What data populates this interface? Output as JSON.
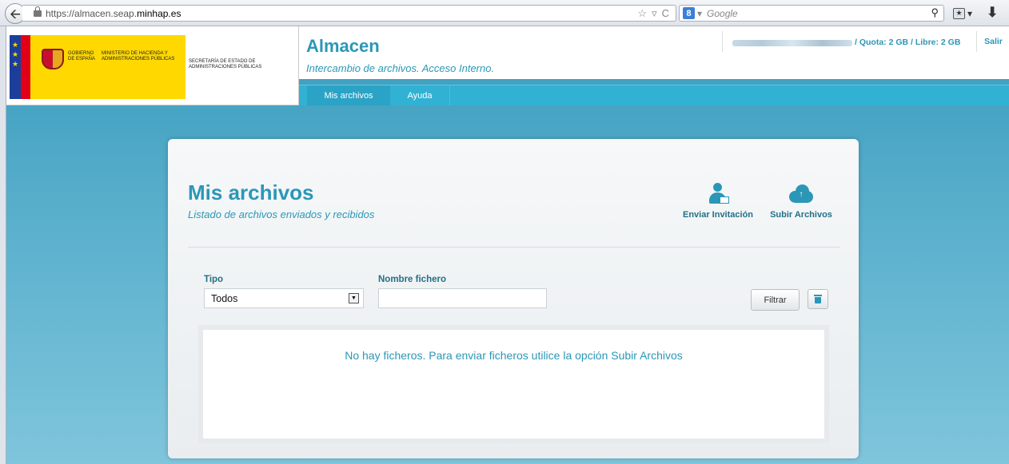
{
  "browser": {
    "url_prefix": "https://almacen.seap.",
    "url_host": "minhap.es",
    "search_engine_glyph": "8",
    "search_placeholder": "Google",
    "reload_glyph": "C",
    "star_glyph": "☆",
    "search_go_glyph": "⚲",
    "download_glyph": "⬇"
  },
  "header": {
    "gobierno_text": "GOBIERNO DE ESPAÑA",
    "ministerio_text": "MINISTERIO DE HACIENDA Y ADMINISTRACIONES PÚBLICAS",
    "secretaria_text": "SECRETARÍA DE ESTADO DE ADMINISTRACIONES PÚBLICAS",
    "app_title": "Almacen",
    "app_subtitle": "Intercambio de archivos. Acceso Interno.",
    "quota_text": "/ Quota: 2 GB / Libre: 2 GB",
    "logout_label": "Salir"
  },
  "nav": {
    "tabs": [
      {
        "label": "Mis archivos",
        "active": true
      },
      {
        "label": "Ayuda",
        "active": false
      }
    ]
  },
  "main": {
    "title": "Mis archivos",
    "subtitle": "Listado de archivos enviados y recibidos",
    "actions": {
      "invite_label": "Enviar Invitación",
      "upload_label": "Subir Archivos"
    },
    "filters": {
      "tipo_label": "Tipo",
      "tipo_value": "Todos",
      "nombre_label": "Nombre fichero",
      "nombre_value": "",
      "filter_button": "Filtrar"
    },
    "empty_message": "No hay ficheros. Para enviar ficheros utilice la opción Subir Archivos"
  },
  "colors": {
    "accent": "#2b97b7",
    "nav_bar": "#31b1d3",
    "page_background": "#4aa6c5"
  }
}
